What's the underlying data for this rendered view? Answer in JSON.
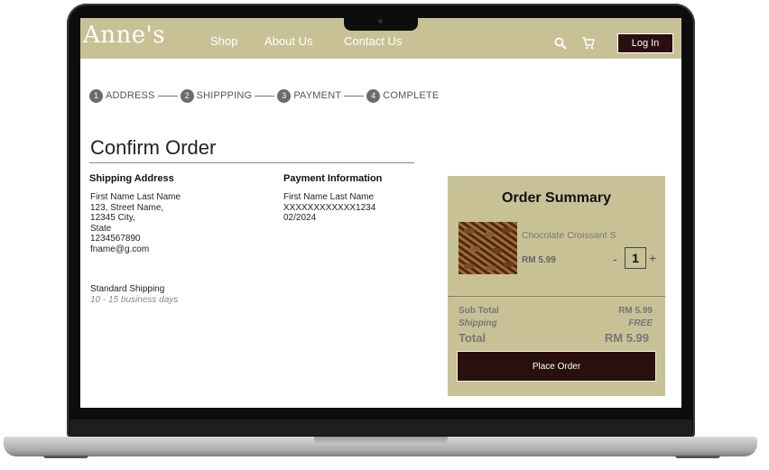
{
  "header": {
    "logo": "Anne's",
    "nav": [
      "Shop",
      "About Us",
      "Contact Us"
    ],
    "login_label": "Log In",
    "icons": [
      "search-icon",
      "cart-icon"
    ]
  },
  "stepper": {
    "steps": [
      {
        "num": "1",
        "label": "ADDRESS"
      },
      {
        "num": "2",
        "label": "SHIPPPING"
      },
      {
        "num": "3",
        "label": "PAYMENT"
      },
      {
        "num": "4",
        "label": "COMPLETE"
      }
    ]
  },
  "page_title": "Confirm Order",
  "shipping_address": {
    "heading": "Shipping Address",
    "lines": [
      "First Name Last Name",
      "123, Street Name,",
      "12345 City,",
      "State",
      "1234567890",
      "fname@g.com"
    ]
  },
  "payment": {
    "heading": "Payment Information",
    "lines": [
      "First Name Last Name",
      "XXXXXXXXXXXX1234",
      "02/2024"
    ]
  },
  "shipping_method": {
    "name": "Standard Shipping",
    "duration": "10 - 15 business days"
  },
  "summary": {
    "title": "Order Summary",
    "item": {
      "name": "Chocolate Croissant S",
      "price": "RM 5.99",
      "quantity": "1",
      "minus": "-",
      "plus": "+"
    },
    "subtotal_label": "Sub Total",
    "subtotal_value": "RM 5.99",
    "shipping_label": "Shipping",
    "shipping_value": "FREE",
    "total_label": "Total",
    "total_value": "RM 5.99",
    "place_order_label": "Place Order"
  },
  "colors": {
    "accent": "#c9c196",
    "button_dark": "#2a0f0f"
  }
}
